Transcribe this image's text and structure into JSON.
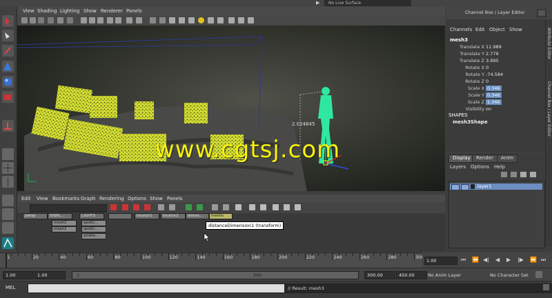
{
  "topbar": {
    "live_surface": "No Live Surface"
  },
  "viewport": {
    "menu": [
      "View",
      "Shading",
      "Lighting",
      "Show",
      "Renderer",
      "Panels"
    ],
    "dimension_label": "2.024845",
    "watermark": "www.cgtsj.com"
  },
  "panel_title": "Channel Box / Layer Editor",
  "channel_box": {
    "menu": [
      "Channels",
      "Edit",
      "Object",
      "Show"
    ],
    "object_name": "mesh3",
    "attributes": [
      {
        "label": "Translate X",
        "value": "11.989",
        "highlight": false
      },
      {
        "label": "Translate Y",
        "value": "2.779",
        "highlight": false
      },
      {
        "label": "Translate Z",
        "value": "3.995",
        "highlight": false
      },
      {
        "label": "Rotate X",
        "value": "0",
        "highlight": false
      },
      {
        "label": "Rotate Y",
        "value": "-74.584",
        "highlight": false
      },
      {
        "label": "Rotate Z",
        "value": "0",
        "highlight": false
      },
      {
        "label": "Scale X",
        "value": "0.346",
        "highlight": true
      },
      {
        "label": "Scale Y",
        "value": "0.346",
        "highlight": true
      },
      {
        "label": "Scale Z",
        "value": "1.346",
        "highlight": true
      },
      {
        "label": "Visibility",
        "value": "on",
        "highlight": false
      }
    ],
    "shapes_header": "SHAPES",
    "shape_name": "mesh3Shape"
  },
  "side_tabs": [
    "Attribute Editor",
    "Channel Box / Layer Editor"
  ],
  "layer_editor": {
    "tabs": [
      "Display",
      "Render",
      "Anim"
    ],
    "menu": [
      "Layers",
      "Options",
      "Help"
    ],
    "layer_name": "layer1"
  },
  "hypergraph": {
    "menu": [
      "Edit",
      "View",
      "Bookmarks",
      "Graph",
      "Rendering",
      "Options",
      "Show",
      "Panels"
    ],
    "top_nodes": [
      "persp",
      "DISPL...",
      "LIGHTS",
      "",
      "locator1",
      "locator2",
      "distan...",
      "meshs"
    ],
    "child_nodes_a": [
      "mesh1",
      "mesh2"
    ],
    "child_nodes_b": [
      "spotLi...",
      "spotLi...",
      "ambie..."
    ],
    "tooltip": "distanceDimension1 (transform)"
  },
  "timeline": {
    "labels": [
      "1",
      "20",
      "40",
      "60",
      "80",
      "100",
      "120",
      "140",
      "160",
      "180",
      "200",
      "220",
      "240",
      "260",
      "280",
      "300"
    ],
    "current_frame": "1.00"
  },
  "range": {
    "start": "1.00",
    "playback_start": "1.00",
    "slider_start": "1",
    "slider_end": "300",
    "playback_end": "300.00",
    "end": "450.00",
    "anim_layer": "No Anim Layer",
    "character_set": "No Character Set"
  },
  "command_line": {
    "label": "MEL",
    "result": "// Result: mesh3"
  },
  "colors": {
    "accent_highlight": "#6a8fc0",
    "watermark": "#f7f20a",
    "character": "#2ee8a0",
    "boxes": "#d7dc32"
  }
}
